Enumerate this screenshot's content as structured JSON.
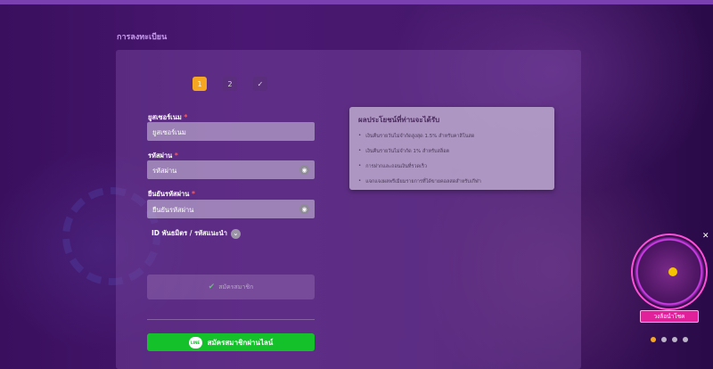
{
  "page": {
    "title": "การลงทะเบียน"
  },
  "steps": [
    "1",
    "2",
    "✓"
  ],
  "form": {
    "username_label": "ยูสเซอร์เนม",
    "username_placeholder": "ยูสเซอร์เนม",
    "password_label": "รหัสผ่าน",
    "password_placeholder": "รหัสผ่าน",
    "confirm_label": "ยืนยันรหัสผ่าน",
    "confirm_placeholder": "ยืนยันรหัสผ่าน",
    "required_mark": "*",
    "referral_label": "ID พันธมิตร / รหัสแนะนำ",
    "submit_label": "สมัครสมาชิก",
    "line_button_label": "สมัครสมาชิกผ่านไลน์",
    "line_logo": "LINE"
  },
  "benefits": {
    "title": "ผลประโยชน์ที่ท่านจะได้รับ",
    "items": [
      "เงินคืนรายวันไม่จำกัดสูงสุด 1.5% สำหรับคาสิโนสด",
      "เงินคืนรายวันไม่จำกัด 1% สำหรับสล็อต",
      "การฝากและถอนเงินที่รวดเร็ว",
      "แจกแจงผลพรีเมียมรายการที่ได้ขายคอลสดสำหรับเกีฬา"
    ]
  },
  "wheel": {
    "button_label": "วงล้อนำโชค",
    "close": "✕"
  },
  "carousel": {
    "active_index": 0,
    "count": 4
  }
}
